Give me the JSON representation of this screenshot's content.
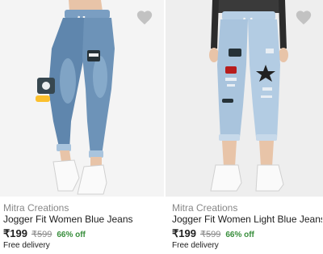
{
  "products": [
    {
      "brand": "Mitra Creations",
      "title": "Jogger Fit Women Blue Jeans",
      "price": "₹199",
      "mrp": "₹599",
      "discount": "66% off",
      "delivery": "Free delivery",
      "image_alt": "Blue distressed jogger jeans with patches",
      "denim_color": "#5f86ad",
      "wishlist_icon": "heart-icon"
    },
    {
      "brand": "Mitra Creations",
      "title": "Jogger Fit Women Light Blue Jeans",
      "price": "₹199",
      "mrp": "₹599",
      "discount": "66% off",
      "delivery": "Free delivery",
      "image_alt": "Light blue ripped jogger jeans with star patch",
      "denim_color": "#a9c4dd",
      "wishlist_icon": "heart-icon"
    }
  ],
  "colors": {
    "discount_green": "#388e3c",
    "muted_text": "#878787",
    "heart_gray": "#c2c2c2"
  }
}
